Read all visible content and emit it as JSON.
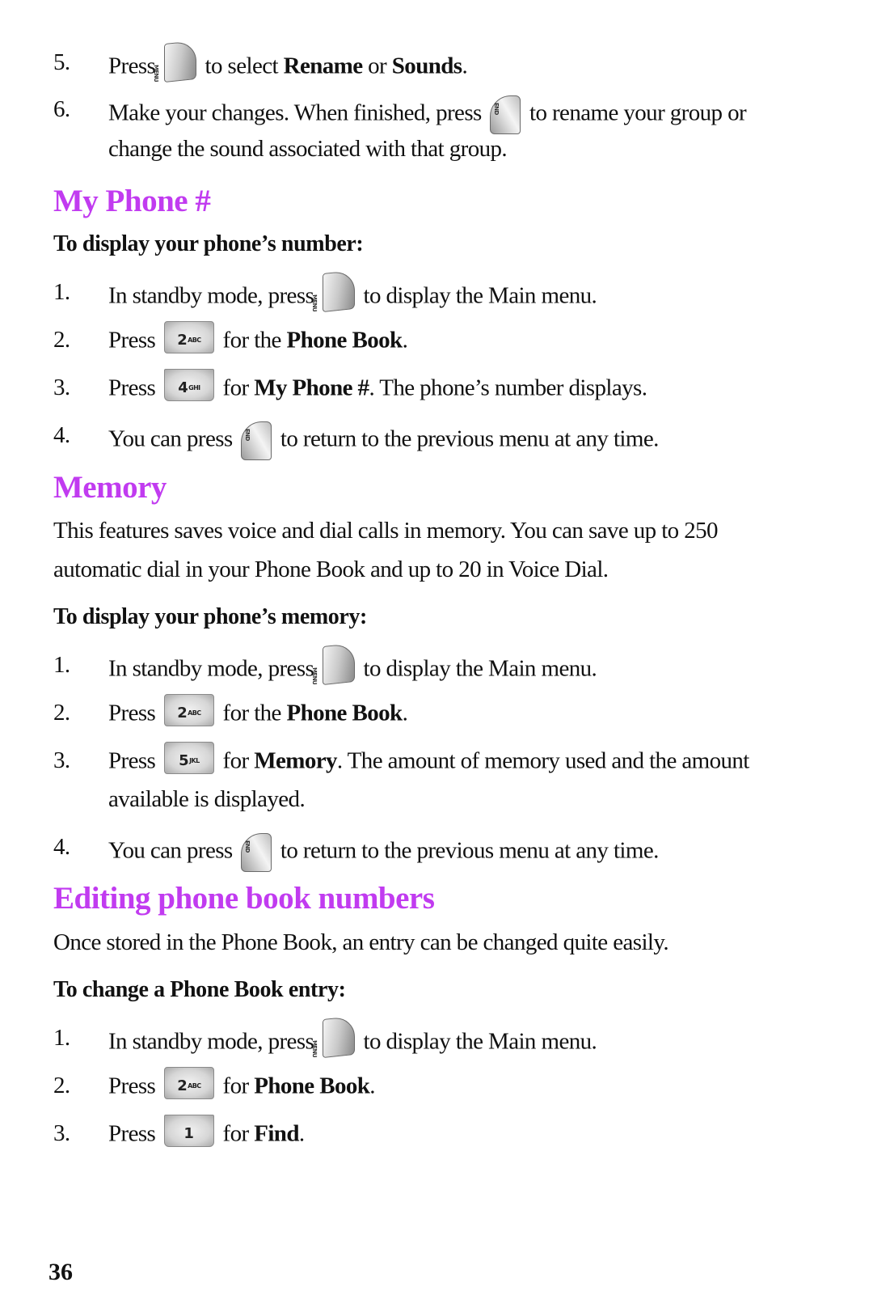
{
  "colors": {
    "heading": "#C13BF0",
    "text": "#111111"
  },
  "intro_steps": [
    {
      "num": "5.",
      "pre": "Press",
      "icon": "menu-key-icon",
      "post1": "to select ",
      "bold1": "Rename",
      "post2": " or ",
      "bold2": "Sounds",
      "post3": "."
    },
    {
      "num": "6.",
      "pre": "Make your changes. When finished, press",
      "icon": "end-key-icon",
      "post1": "to rename your group or",
      "cont": "change the sound associated with that group."
    }
  ],
  "sections": [
    {
      "title": "My Phone #",
      "subheading": "To display your phone’s number:",
      "steps": [
        {
          "num": "1.",
          "pre": "In standby mode, press",
          "icon": "menu-key-icon",
          "post": "to display the Main menu."
        },
        {
          "num": "2.",
          "pre": "Press",
          "key_digit": "2",
          "key_letters": "ABC",
          "post1": "for the ",
          "bold": "Phone Book",
          "post2": "."
        },
        {
          "num": "3.",
          "pre": "Press",
          "key_digit": "4",
          "key_letters": "GHI",
          "post1": "for ",
          "bold": "My Phone #",
          "post2": ". The phone’s number displays."
        },
        {
          "num": "4.",
          "pre": "You can press",
          "icon": "end-key-icon",
          "post": "to return to the previous menu at any time."
        }
      ]
    },
    {
      "title": "Memory",
      "paragraph": [
        "This features saves voice and dial calls in memory. You can save up to 250",
        "automatic dial in your Phone Book and up to 20 in Voice Dial."
      ],
      "subheading": "To display your phone’s memory:",
      "steps": [
        {
          "num": "1.",
          "pre": "In standby mode, press",
          "icon": "menu-key-icon",
          "post": "to display the Main menu."
        },
        {
          "num": "2.",
          "pre": "Press",
          "key_digit": "2",
          "key_letters": "ABC",
          "post1": "for the ",
          "bold": "Phone Book",
          "post2": "."
        },
        {
          "num": "3.",
          "pre": "Press",
          "key_digit": "5",
          "key_letters": "JKL",
          "post1": "for ",
          "bold": "Memory",
          "post2": ". The amount of memory used and the amount",
          "cont": "available is displayed."
        },
        {
          "num": "4.",
          "pre": "You can press",
          "icon": "end-key-icon",
          "post": "to return to the previous menu at any time."
        }
      ]
    },
    {
      "title": "Editing phone book numbers",
      "paragraph": [
        "Once stored in the Phone Book, an entry can be changed quite easily."
      ],
      "subheading": "To change a Phone Book entry:",
      "steps": [
        {
          "num": "1.",
          "pre": "In standby mode, press",
          "icon": "menu-key-icon",
          "post": "to display the Main menu."
        },
        {
          "num": "2.",
          "pre": "Press",
          "key_digit": "2",
          "key_letters": "ABC",
          "post1": "for ",
          "bold": "Phone Book",
          "post2": "."
        },
        {
          "num": "3.",
          "pre": "Press",
          "key_digit": "1",
          "key_letters": "",
          "post1": "for ",
          "bold": "Find",
          "post2": "."
        }
      ]
    }
  ],
  "page_number": "36"
}
